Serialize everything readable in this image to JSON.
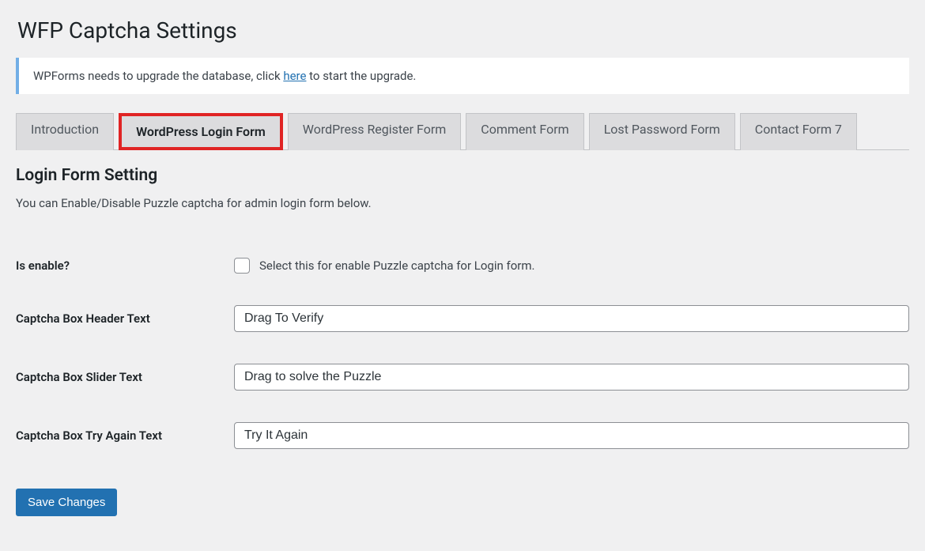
{
  "page_title": "WFP Captcha Settings",
  "notice": {
    "before_link": "WPForms needs to upgrade the database, click ",
    "link_text": "here",
    "after_link": " to start the upgrade."
  },
  "tabs": [
    {
      "label": "Introduction",
      "active": false
    },
    {
      "label": "WordPress Login Form",
      "active": true
    },
    {
      "label": "WordPress Register Form",
      "active": false
    },
    {
      "label": "Comment Form",
      "active": false
    },
    {
      "label": "Lost Password Form",
      "active": false
    },
    {
      "label": "Contact Form 7",
      "active": false
    }
  ],
  "section": {
    "heading": "Login Form Setting",
    "description": "You can Enable/Disable Puzzle captcha for admin login form below."
  },
  "fields": {
    "is_enable": {
      "label": "Is enable?",
      "checkbox_label": "Select this for enable Puzzle captcha for Login form."
    },
    "header_text": {
      "label": "Captcha Box Header Text",
      "value": "Drag To Verify"
    },
    "slider_text": {
      "label": "Captcha Box Slider Text",
      "value": "Drag to solve the Puzzle"
    },
    "tryagain_text": {
      "label": "Captcha Box Try Again Text",
      "value": "Try It Again"
    }
  },
  "submit_label": "Save Changes"
}
